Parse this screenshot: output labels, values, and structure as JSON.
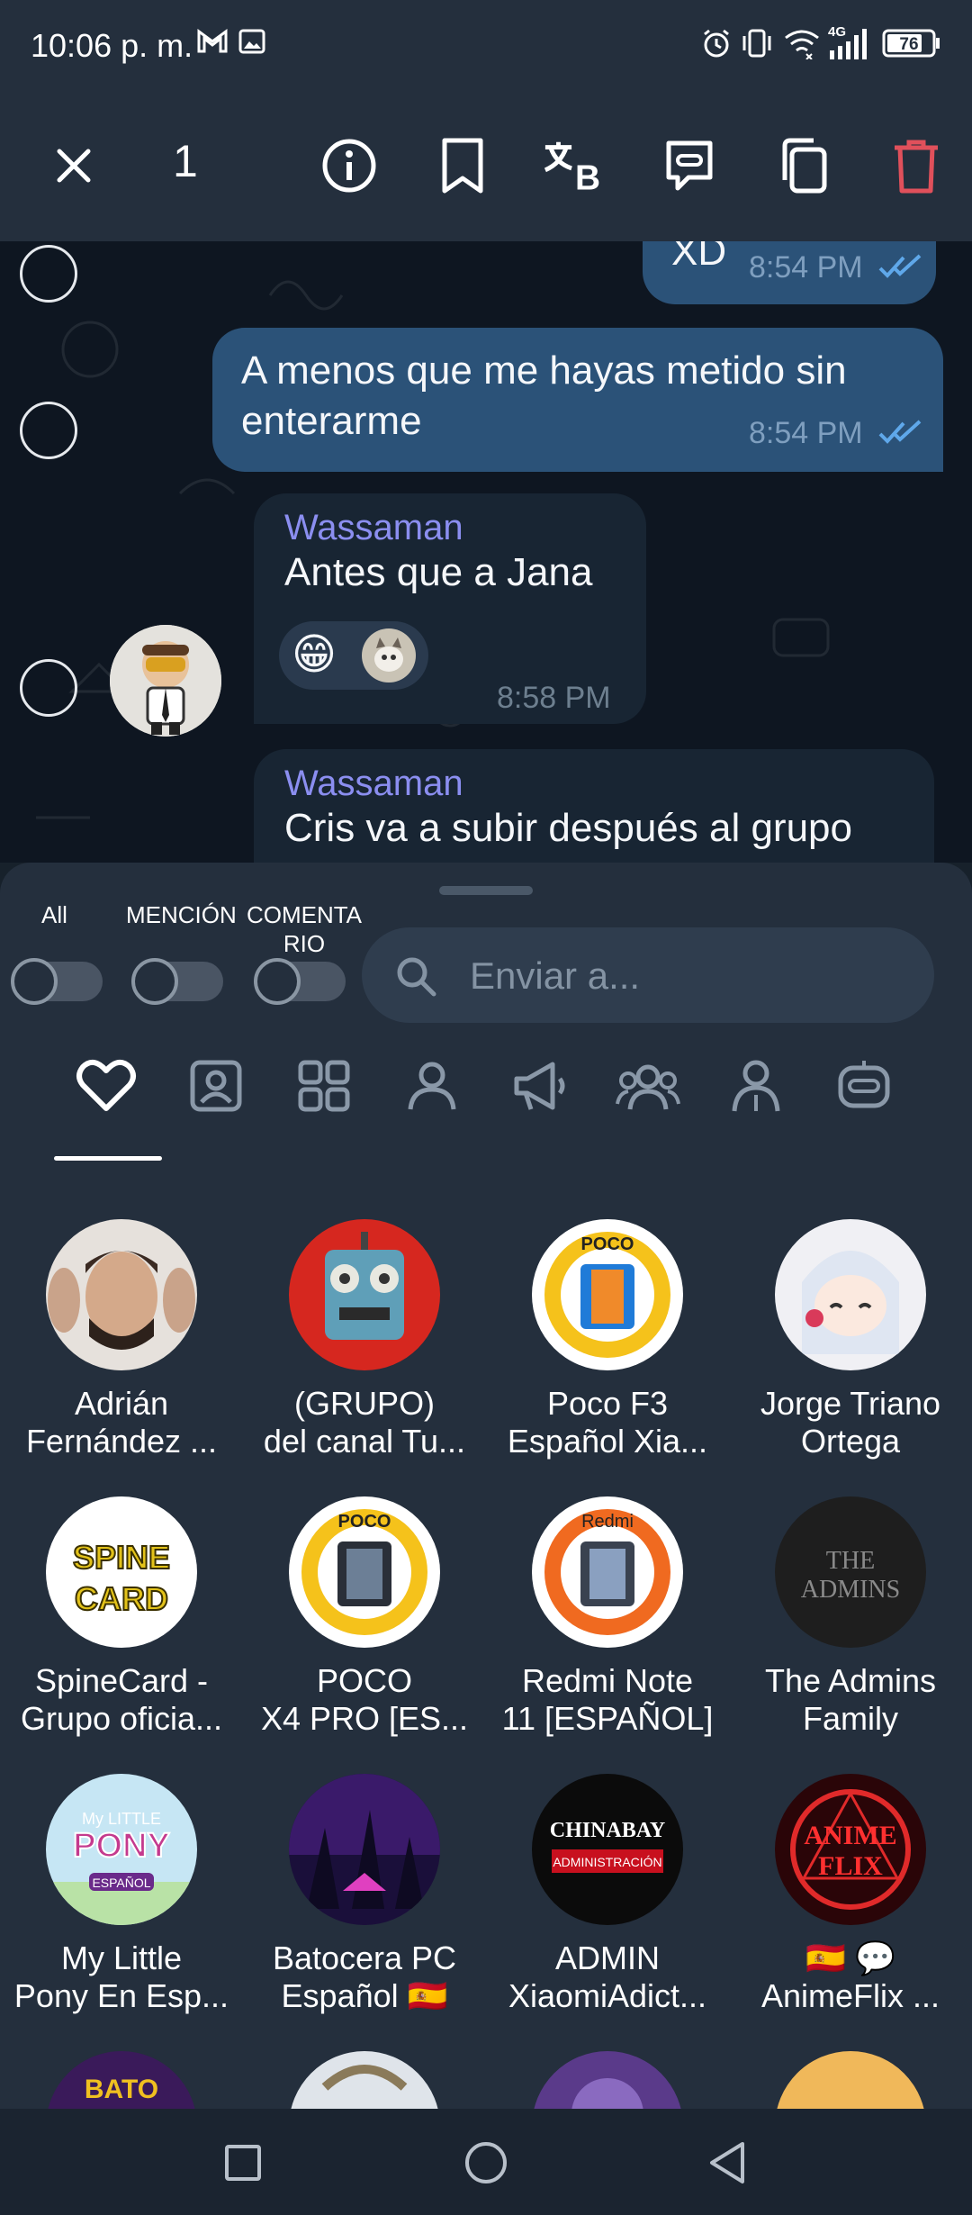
{
  "status_bar": {
    "time": "10:06 p. m.",
    "network": "4G",
    "battery": "76"
  },
  "action_bar": {
    "selected_count": "1"
  },
  "messages": [
    {
      "text": "XD",
      "time": "8:54 PM",
      "outgoing": true
    },
    {
      "text_line1": "A menos que me hayas metido sin",
      "text_line2": "enterarme",
      "time": "8:54 PM",
      "outgoing": true
    },
    {
      "sender": "Wassaman",
      "text": "Antes que a Jana",
      "time": "8:58 PM",
      "reaction_emoji": "😁"
    },
    {
      "sender": "Wassaman",
      "text": "Cris va a subir después al grupo"
    }
  ],
  "share_sheet": {
    "toggles": [
      {
        "label": "All",
        "on": false
      },
      {
        "label": "MENCIÓN",
        "on": false
      },
      {
        "label_line1": "COMENTA",
        "label_line2": "RIO",
        "on": false
      }
    ],
    "search_placeholder": "Enviar a...",
    "tabs": [
      "favorites-icon",
      "contact-card-icon",
      "apps-grid-icon",
      "person-icon",
      "megaphone-icon",
      "group-icon",
      "user-icon",
      "bot-icon"
    ],
    "contacts": [
      {
        "line1": "Adrián",
        "line2": "Fernández ..."
      },
      {
        "line1": "(GRUPO)",
        "line2": "del canal Tu..."
      },
      {
        "line1": "Poco F3",
        "line2": "Español Xia..."
      },
      {
        "line1": "Jorge Triano",
        "line2": "Ortega"
      },
      {
        "line1": "SpineCard -",
        "line2": "Grupo oficia..."
      },
      {
        "line1": "POCO",
        "line2": "X4 PRO [ES..."
      },
      {
        "line1": "Redmi Note",
        "line2": "11 [ESPAÑOL]"
      },
      {
        "line1": "The Admins",
        "line2": "Family"
      },
      {
        "line1": "My Little",
        "line2": "Pony En Esp..."
      },
      {
        "line1": "Batocera PC",
        "line2": "Español 🇪🇸"
      },
      {
        "line1": "ADMIN",
        "line2": "XiaomiAdict..."
      },
      {
        "line1": "🇪🇸 💬",
        "line2": "AnimeFlix ..."
      }
    ],
    "avatar_texts": {
      "poco": "POCO",
      "spine": "SPINE CARD",
      "redmi": "Redmi",
      "admins1": "THE",
      "admins2": "ADMINS",
      "pony": "My LITTLE PONY",
      "pony_sub": "ESPAÑOL",
      "chinabay": "CHINABAY",
      "chinabay_sub": "ADMINISTRACIÓN",
      "anime": "ANIME FLIX",
      "bato": "BATO"
    }
  },
  "colors": {
    "accent": "#8b8ef0",
    "delete": "#e0505b",
    "outgoing_bubble": "#2b5278",
    "incoming_bubble": "#182533"
  }
}
